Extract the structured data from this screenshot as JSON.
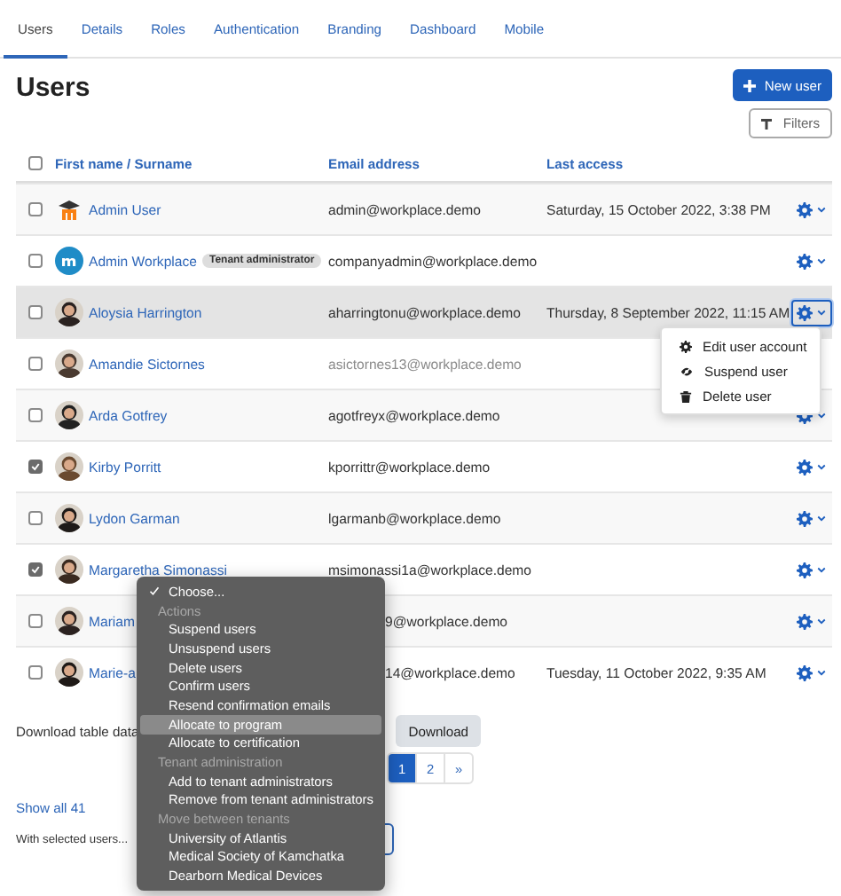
{
  "tabs": [
    {
      "label": "Users",
      "selected": true
    },
    {
      "label": "Details",
      "selected": false
    },
    {
      "label": "Roles",
      "selected": false
    },
    {
      "label": "Authentication",
      "selected": false
    },
    {
      "label": "Branding",
      "selected": false
    },
    {
      "label": "Dashboard",
      "selected": false
    },
    {
      "label": "Mobile",
      "selected": false
    }
  ],
  "heading": "Users",
  "new_user_button": "New user",
  "filters_button": "Filters",
  "table": {
    "select_all": {
      "checked": false
    },
    "columns": [
      {
        "label": "First name / Surname"
      },
      {
        "label": "Email address"
      },
      {
        "label": "Last access"
      }
    ],
    "rows": [
      {
        "checked": false,
        "kind": "logo",
        "name": "Admin User",
        "email": "admin@workplace.demo",
        "last_access": "Saturday, 15 October 2022, 3:38 PM",
        "highlighted": false,
        "menu_open": false,
        "covered": false
      },
      {
        "checked": false,
        "kind": "round-logo",
        "name": "Admin Workplace",
        "badge": "Tenant administrator",
        "email": "companyadmin@workplace.demo",
        "highlighted": false,
        "menu_open": false,
        "covered": false
      },
      {
        "checked": false,
        "kind": "photo",
        "name": "Aloysia Harrington",
        "email": "aharringtonu@workplace.demo",
        "last_access": "Thursday, 8 September 2022, 11:15 AM",
        "highlighted": true,
        "menu_open": true,
        "covered": false
      },
      {
        "checked": false,
        "kind": "photo",
        "name": "Amandie Sictornes",
        "email": "asictornes13@workplace.demo",
        "highlighted": false,
        "menu_open": false,
        "covered": false,
        "suspended": true
      },
      {
        "checked": false,
        "kind": "photo",
        "name": "Arda Gotfrey",
        "email": "agotfreyx@workplace.demo",
        "highlighted": false,
        "menu_open": false,
        "covered": false
      },
      {
        "checked": true,
        "kind": "photo",
        "name": "Kirby Porritt",
        "email": "kporrittr@workplace.demo",
        "highlighted": false,
        "menu_open": false,
        "covered": false
      },
      {
        "checked": false,
        "kind": "photo",
        "name": "Lydon Garman",
        "email": "lgarmanb@workplace.demo",
        "highlighted": false,
        "menu_open": false,
        "covered": false
      },
      {
        "checked": true,
        "kind": "photo",
        "name": "Margaretha Simonassi",
        "email": "msimonassi1a@workplace.demo",
        "highlighted": false,
        "menu_open": false,
        "covered": false
      },
      {
        "checked": false,
        "kind": "photo",
        "name": "Mariam",
        "email": "9@workplace.demo",
        "highlighted": false,
        "menu_open": false,
        "covered": true
      },
      {
        "checked": false,
        "kind": "photo",
        "name": "Marie-a",
        "email": "14@workplace.demo",
        "last_access": "Tuesday, 11 October 2022, 9:35 AM",
        "highlighted": false,
        "menu_open": false,
        "covered": true
      }
    ]
  },
  "row_menu": [
    {
      "kind": "edit",
      "label": "Edit user account"
    },
    {
      "kind": "suspend",
      "label": "Suspend user"
    },
    {
      "kind": "delete",
      "label": "Delete user"
    }
  ],
  "download": {
    "label": "Download table data",
    "button": "Download"
  },
  "pagination": [
    {
      "label": "1",
      "selected": true
    },
    {
      "label": "2",
      "selected": false
    },
    {
      "label": "»",
      "selected": false
    }
  ],
  "show_all": "Show all 41",
  "bulk": {
    "label": "With selected users...",
    "options": [
      {
        "kind": "option",
        "label": "Choose...",
        "selected": true,
        "highlighted": false
      },
      {
        "kind": "group",
        "label": "Actions"
      },
      {
        "kind": "option",
        "label": "Suspend users",
        "selected": false,
        "highlighted": false
      },
      {
        "kind": "option",
        "label": "Unsuspend users",
        "selected": false,
        "highlighted": false
      },
      {
        "kind": "option",
        "label": "Delete users",
        "selected": false,
        "highlighted": false
      },
      {
        "kind": "option",
        "label": "Confirm users",
        "selected": false,
        "highlighted": false
      },
      {
        "kind": "option",
        "label": "Resend confirmation emails",
        "selected": false,
        "highlighted": false
      },
      {
        "kind": "option",
        "label": "Allocate to program",
        "selected": false,
        "highlighted": true
      },
      {
        "kind": "option",
        "label": "Allocate to certification",
        "selected": false,
        "highlighted": false
      },
      {
        "kind": "group",
        "label": "Tenant administration"
      },
      {
        "kind": "option",
        "label": "Add to tenant administrators",
        "selected": false,
        "highlighted": false
      },
      {
        "kind": "option",
        "label": "Remove from tenant administrators",
        "selected": false,
        "highlighted": false
      },
      {
        "kind": "group",
        "label": "Move between tenants"
      },
      {
        "kind": "option",
        "label": "University of Atlantis",
        "selected": false,
        "highlighted": false
      },
      {
        "kind": "option",
        "label": "Medical Society of Kamchatka",
        "selected": false,
        "highlighted": false
      },
      {
        "kind": "option",
        "label": "Dearborn Medical Devices",
        "selected": false,
        "highlighted": false
      }
    ]
  }
}
